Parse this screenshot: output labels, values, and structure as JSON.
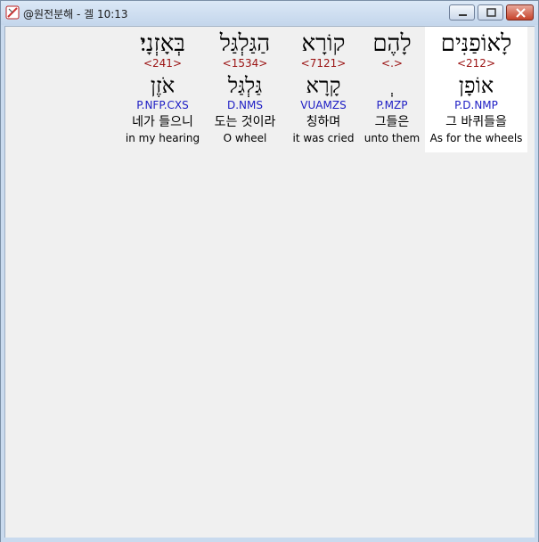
{
  "window": {
    "title": "@원전분해 - 겔 10:13"
  },
  "words": [
    {
      "hebrew": "לָאוֹפַנִּים",
      "strong": "<212>",
      "lemma": "אוֹפָן",
      "morph": "P.D.NMP",
      "korean": "그 바퀴들을",
      "english": "As for the wheels",
      "selected": true
    },
    {
      "hebrew": "לָהֶם",
      "strong": "<.>",
      "lemma": "ְ",
      "morph": "P.MZP",
      "korean": "그들은",
      "english": "unto them",
      "selected": false
    },
    {
      "hebrew": "קוֹרָא",
      "strong": "<7121>",
      "lemma": "קָרָא",
      "morph": "VUAMZS",
      "korean": "칭하며",
      "english": "it was cried",
      "selected": false
    },
    {
      "hebrew": "הַגַּלְגַּל",
      "strong": "<1534>",
      "lemma": "גַּלְגַּל",
      "morph": "D.NMS",
      "korean": "도는 것이라",
      "english": "O wheel",
      "selected": false
    },
    {
      "hebrew": "בְּאָזְנָי׃",
      "strong": "<241>",
      "lemma": "אֹזֶן",
      "morph": "P.NFP.CXS",
      "korean": "네가 들으니",
      "english": "in my hearing",
      "selected": false
    }
  ]
}
